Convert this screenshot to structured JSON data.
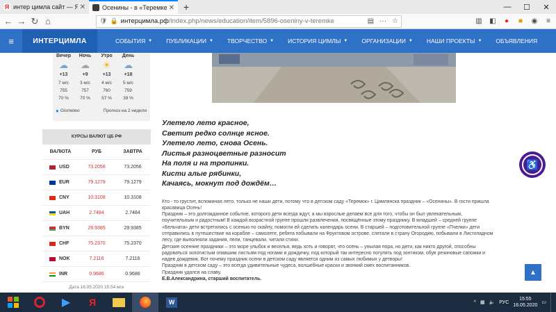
{
  "browser": {
    "tabs": [
      {
        "title": "интер цимла сайт — Яндекс:",
        "icon": "yandex-icon",
        "color": "#e22"
      },
      {
        "title": "Осенины - в «Теремке»!",
        "icon": "site-favicon",
        "color": "#3a3a3a"
      }
    ],
    "url_host": "интерцимла.рф",
    "url_path": "/index.php/news/education/item/5896-oseniny-v-teremke"
  },
  "site": {
    "brand": "ИНТЕРЦИМЛА",
    "menu": [
      {
        "label": "СОБЫТИЯ",
        "dropdown": true
      },
      {
        "label": "ПУБЛИКАЦИИ",
        "dropdown": true
      },
      {
        "label": "ТВОРЧЕСТВО",
        "dropdown": true
      },
      {
        "label": "ИСТОРИЯ ЦИМЛЫ",
        "dropdown": true
      },
      {
        "label": "ОРГАНИЗАЦИИ",
        "dropdown": true
      },
      {
        "label": "НАШИ ПРОЕКТЫ",
        "dropdown": true
      },
      {
        "label": "ОБЪЯВЛЕНИЯ",
        "dropdown": false
      }
    ]
  },
  "weather": {
    "columns": [
      {
        "name": "Вечер",
        "icon": "cloud-rain-icon",
        "temp": "+13",
        "wind": "7 м/с",
        "pressure": "755",
        "humidity": "70 %"
      },
      {
        "name": "Ночь",
        "icon": "moon-cloud-icon",
        "temp": "+9",
        "wind": "3 м/с",
        "pressure": "757",
        "humidity": "70 %"
      },
      {
        "name": "Утро",
        "icon": "sun-icon",
        "temp": "+13",
        "wind": "4 м/с",
        "pressure": "760",
        "humidity": "57 %"
      },
      {
        "name": "День",
        "icon": "cloud-rain-icon",
        "temp": "+18",
        "wind": "5 м/с",
        "pressure": "759",
        "humidity": "39 %"
      }
    ],
    "provider": "Gismeteo",
    "forecast": "Прогноз на 2 недели"
  },
  "currency": {
    "title": "КУРСЫ ВАЛЮТ ЦБ РФ",
    "headers": [
      "ВАЛЮТА",
      "РУБ",
      "ЗАВТРА"
    ],
    "rows": [
      {
        "code": "USD",
        "rub": "73.2056",
        "tomorrow": "73.2056",
        "flag": "#b22234"
      },
      {
        "code": "EUR",
        "rub": "79.1279",
        "tomorrow": "79.1279",
        "flag": "#003399"
      },
      {
        "code": "CNY",
        "rub": "10.3108",
        "tomorrow": "10.3108",
        "flag": "#de2910"
      },
      {
        "code": "UAH",
        "rub": "2.7484",
        "tomorrow": "2.7484",
        "flag": "#0057b7"
      },
      {
        "code": "BYN",
        "rub": "29.9385",
        "tomorrow": "29.9385",
        "flag": "#c8313e"
      },
      {
        "code": "CHF",
        "rub": "75.2370",
        "tomorrow": "75.2370",
        "flag": "#da291c"
      },
      {
        "code": "NOK",
        "rub": "7.2116",
        "tomorrow": "7.2116",
        "flag": "#ba0c2f"
      },
      {
        "code": "INR",
        "rub": "0.9686",
        "tomorrow": "0.9686",
        "flag": "#ff9933"
      }
    ],
    "date": "Дата 16.05.2020 15:54 мск"
  },
  "article": {
    "poem": [
      "Улетело лето красное,",
      "Светит редко солнце ясное.",
      "Улетело лето, снова Осень.",
      "Листья разноцветные разносит",
      "На поля и на тропинки.",
      "Кисти алые рябинки,",
      "Качаясь, мокнут под дождём…"
    ],
    "paragraphs": [
      "Кто - то грустит, вспоминая лето, только не наши дети, потому что в детском саду «Теремок» г. Цимлянска праздник – «Осенины». В гости пришла красавица Осень!",
      "Праздник – это долгожданное событие, которого дети всегда ждут, а мы взрослые делаем все для того, чтобы он был увлекательным, поучительным и радостным! В каждой возрастной группе прошли развлечения, посвящённые этому празднику. В младшей – средней группе «Бельчата» дети встретились с осенью по скайпу, помогли ей сделать календарь осени. В старшей – подготовительной группе «Пчелки» дети отправились в путешествие на корабле – самолете, ребята побывали на Фруктовом острове, слетали в страну Огородию, побывали в Листопадном лесу, где выполняли задания, пели, танцевали, читали стихи.",
      "Детские осенние праздники – это море улыбок и веселья, ведь хоть и говорят, что осень – унылая пора, но дети, как никто другой, способны радоваться золотистым опавшим листьям под ногами и дождичку, под который так интересно погулять под зонтиком, обув резиновые сапожки и надев дождевик. Вот почему праздник осени в детском саду является одним из самых любимых у детворы!",
      "Праздник в детском саду – это всегда удивительные чудеса, волшебные краски и звонкий смех воспитанников.",
      "Праздник удался на славу."
    ],
    "signature": "Е.В.Александрина, старший воспитатель."
  },
  "taskbar": {
    "lang": "РУС",
    "time": "15:55",
    "date": "16.05.2020"
  }
}
